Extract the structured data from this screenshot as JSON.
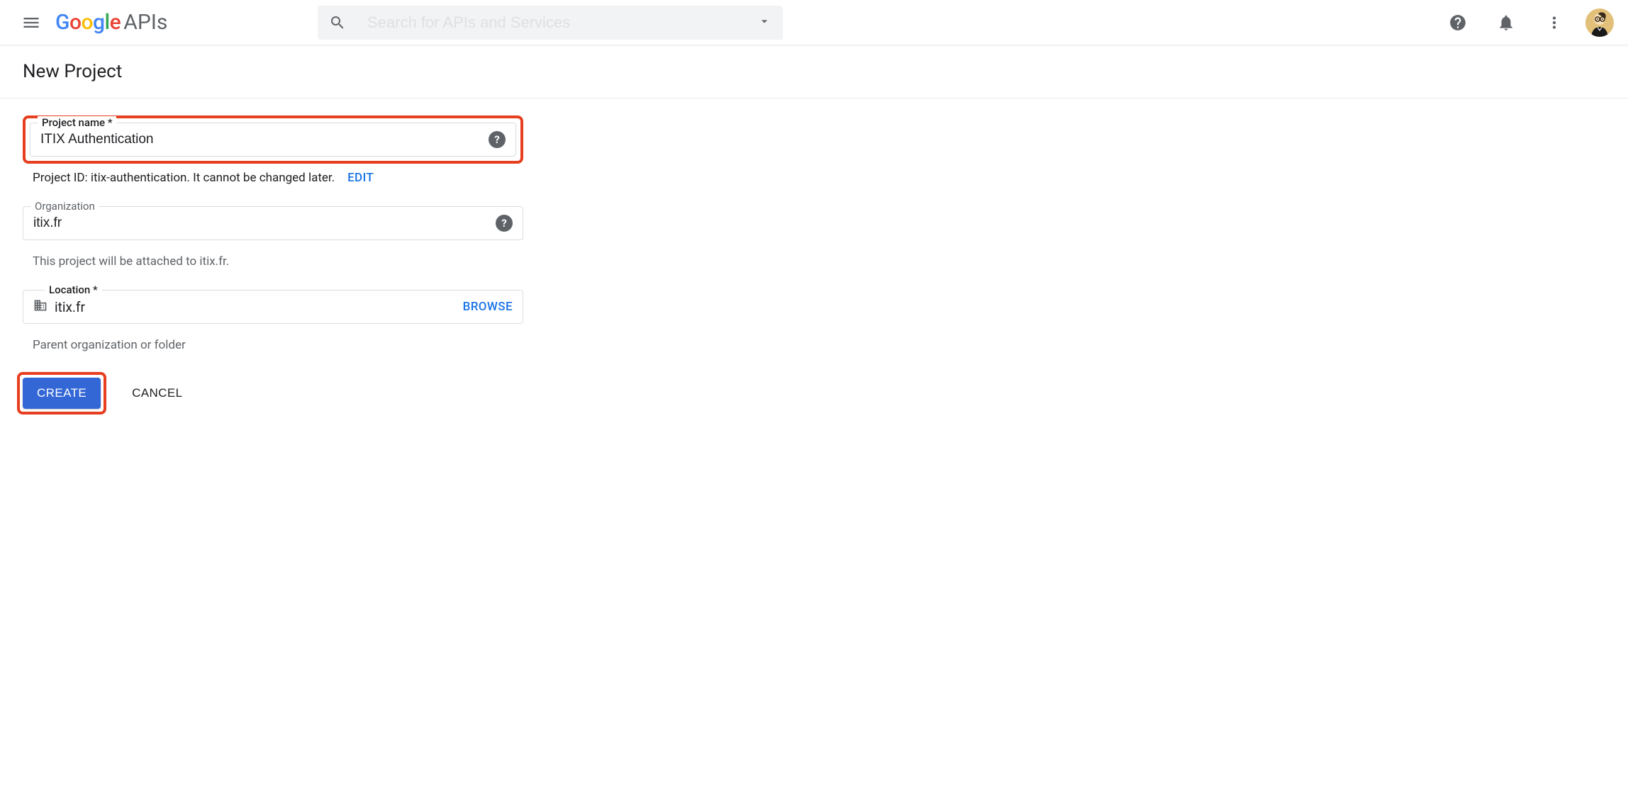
{
  "header": {
    "logo_brand": "Google",
    "logo_suffix": "APIs",
    "search_placeholder": "Search for APIs and Services"
  },
  "page": {
    "title": "New Project"
  },
  "form": {
    "project_name": {
      "label": "Project name",
      "value": "ITIX Authentication"
    },
    "project_id_hint_prefix": "Project ID: ",
    "project_id_hint_value": "itix-authentication. It cannot be changed later.",
    "edit_link": "EDIT",
    "organization": {
      "label": "Organization",
      "value": "itix.fr",
      "hint": "This project will be attached to itix.fr."
    },
    "location": {
      "label": "Location",
      "value": "itix.fr",
      "browse": "BROWSE",
      "hint": "Parent organization or folder"
    },
    "buttons": {
      "create": "CREATE",
      "cancel": "CANCEL"
    }
  }
}
